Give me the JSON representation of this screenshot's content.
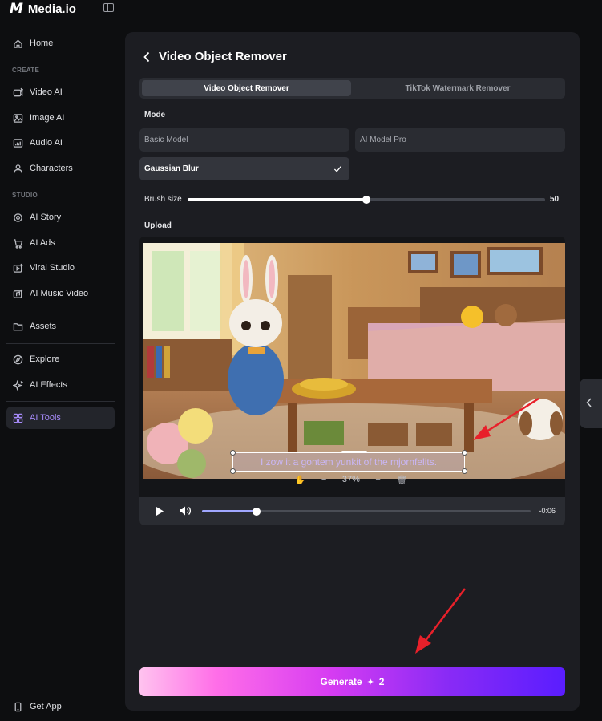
{
  "brand": {
    "logo": "M",
    "name": "Media.io"
  },
  "sidebar": {
    "home": "Home",
    "create_label": "CREATE",
    "create_items": [
      "Video AI",
      "Image AI",
      "Audio AI",
      "Characters"
    ],
    "studio_label": "STUDIO",
    "studio_items": [
      "AI Story",
      "AI Ads",
      "Viral Studio",
      "AI Music Video"
    ],
    "assets": "Assets",
    "explore": "Explore",
    "effects": "AI Effects",
    "tools": "AI Tools",
    "get_app": "Get App"
  },
  "main": {
    "title": "Video Object Remover",
    "tabs": [
      "Video Object Remover",
      "TikTok Watermark Remover"
    ],
    "mode_label": "Mode",
    "modes": [
      "Basic Model",
      "AI Model Pro",
      "Gaussian Blur"
    ],
    "selected_mode": "Gaussian Blur",
    "brush_label": "Brush size",
    "brush_value": 50,
    "brush_fraction": 0.5,
    "upload_label": "Upload",
    "subtitle_text": "I zow it a gontem yunkit of the mjornfelits.",
    "zoom": "37%",
    "time": "-0:06",
    "progress_fraction": 0.167,
    "generate_label": "Generate",
    "generate_cost": "2"
  },
  "colors": {
    "accent": "#a78bfa",
    "active_bg": "#23252b",
    "panel": "#1c1d22"
  }
}
